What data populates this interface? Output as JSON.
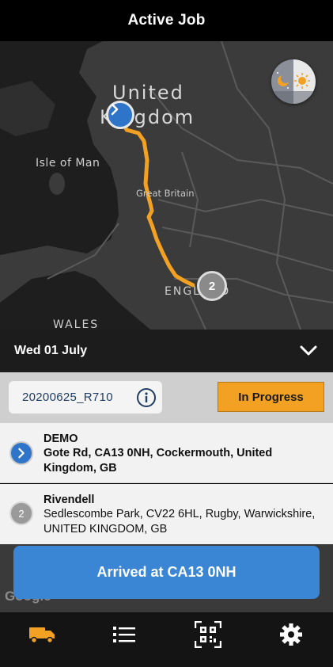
{
  "header": {
    "title": "Active Job"
  },
  "map": {
    "labels": {
      "uk_line1": "United",
      "uk_line2": "Kingdom",
      "isle_of_man": "Isle of Man",
      "great_britain": "Great Britain",
      "england": "ENGLAND",
      "wales": "WALES"
    },
    "markers": {
      "stop2": "2"
    },
    "attribution": "Google",
    "route_color": "#f2a122",
    "day_night_toggle_icon": "day-night-icon"
  },
  "date_bar": {
    "date": "Wed 01 July",
    "expand_icon": "chevron-down-icon"
  },
  "job": {
    "id": "20200625_R710",
    "info_icon": "info-icon",
    "status": "In Progress",
    "status_color": "#f2a122"
  },
  "stops": [
    {
      "name": "DEMO",
      "address": "Gote Rd, CA13 0NH, Cockermouth, United Kingdom, GB",
      "marker_icon": "chevron-right-icon"
    },
    {
      "name": "Rivendell",
      "number": "2",
      "address": "Sedlescombe Park, CV22 6HL, Rugby, Warwickshire, UNITED KINGDOM, GB"
    }
  ],
  "action": {
    "label": "Arrived at CA13 0NH",
    "color": "#3a86d4"
  },
  "tabs": [
    {
      "icon": "truck-icon",
      "active": true,
      "active_color": "#f2a122"
    },
    {
      "icon": "list-icon"
    },
    {
      "icon": "qr-scan-icon"
    },
    {
      "icon": "gear-icon"
    }
  ]
}
